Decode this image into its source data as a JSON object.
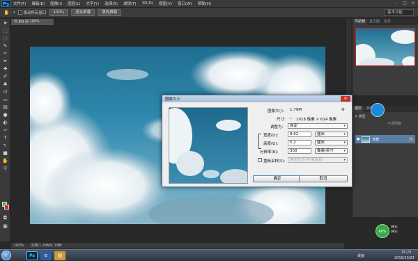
{
  "menubar": {
    "logo": "Ps",
    "items": [
      "文件(F)",
      "编辑(E)",
      "图像(I)",
      "图层(L)",
      "文字(Y)",
      "选择(S)",
      "滤镜(T)",
      "3D(D)",
      "视图(V)",
      "窗口(W)",
      "帮助(H)"
    ],
    "window_buttons": [
      "–",
      "□",
      "×"
    ]
  },
  "options": {
    "scroll_all_label": "滚动所有窗口",
    "zoom_label": "100%",
    "fit_screen_label": "适合屏幕",
    "fill_screen_label": "填充屏幕",
    "workspace_label": "基本功能"
  },
  "document": {
    "tab_label": "云.jpg @ 100%(RGB/8#)",
    "status_zoom": "100%",
    "status_doc": "文档:1.79M/1.79M"
  },
  "panels": {
    "navigator_tabs": [
      "导航器",
      "直方图",
      "信息"
    ],
    "layers_tabs": [
      "图层",
      "通道",
      "路径"
    ],
    "layer_kind": "P 类型",
    "layer_blend": "不透明度",
    "layer_name": "背景"
  },
  "dialog": {
    "title": "图像大小",
    "image_size_label": "图像大小:",
    "image_size_value": "1.79M",
    "dimensions_label": "尺寸:",
    "dimensions_value": "1018 像素 × 614 像素",
    "fit_to_label": "调整为:",
    "fit_to_value": "自定",
    "width_label": "宽度(D):",
    "width_value": "8.62",
    "width_unit": "厘米",
    "height_label": "高度(G):",
    "height_value": "5.2",
    "height_unit": "厘米",
    "resolution_label": "分辨率(R):",
    "resolution_value": "300",
    "resolution_unit": "像素/英寸",
    "resample_label": "重新采样(S):",
    "resample_value": "两次立方(平滑渐变)",
    "ok_label": "确定",
    "cancel_label": "取消",
    "close_label": "✕"
  },
  "taskbar": {
    "tray_left": "桌面",
    "time": "15:25",
    "date": "2015/10/23"
  },
  "widget": {
    "percent": "60%",
    "up_speed": "0K/s",
    "down_speed": "0K/s"
  }
}
